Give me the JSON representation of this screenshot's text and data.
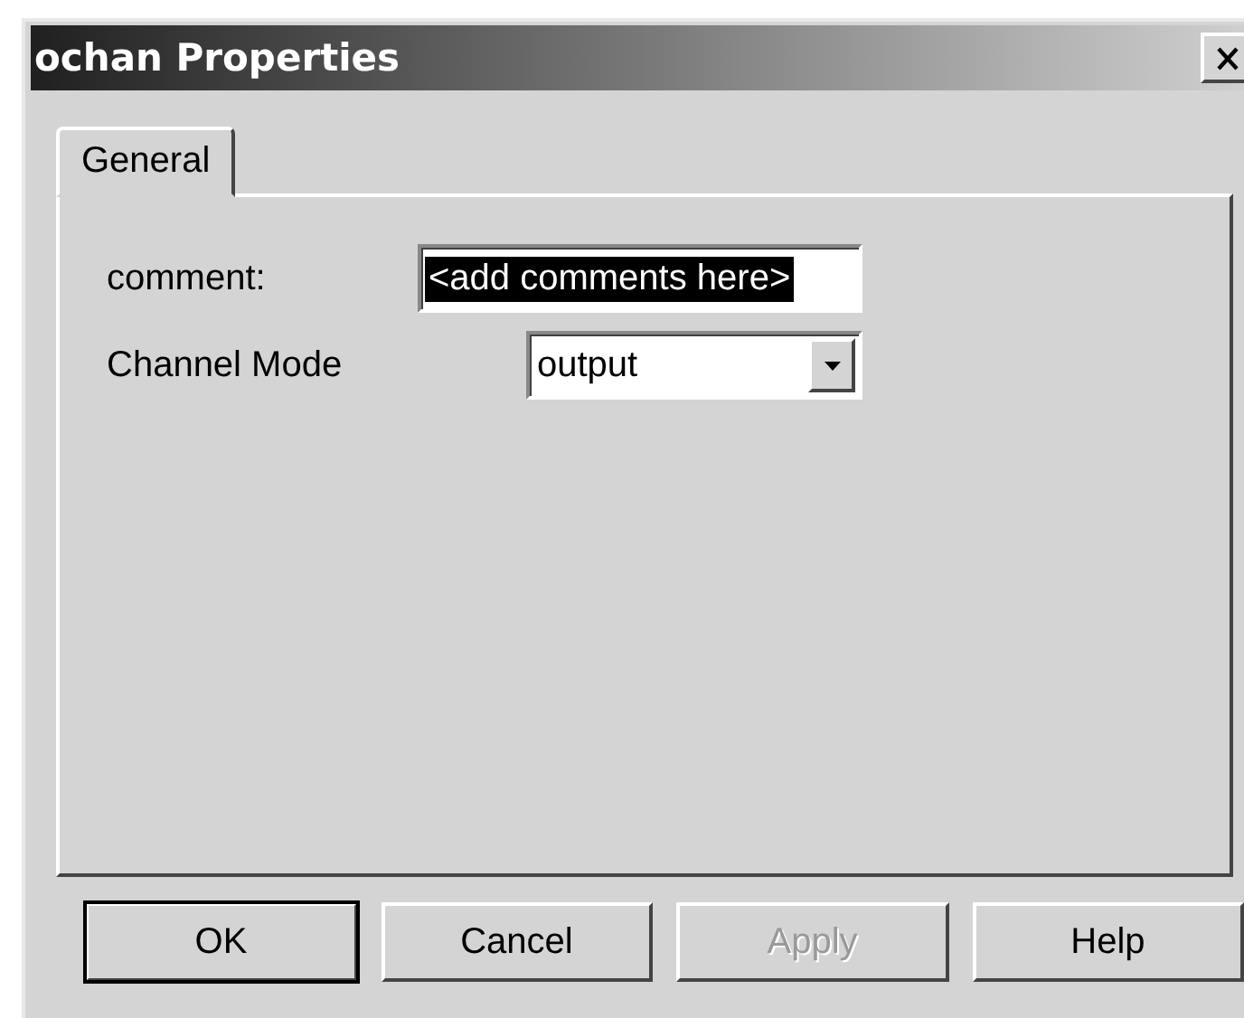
{
  "window": {
    "title": "ochan Properties"
  },
  "tabs": [
    {
      "label": "General",
      "selected": true
    }
  ],
  "fields": [
    {
      "kind": "text",
      "label": "comment:",
      "value": "<add comments here>",
      "text_selected": true
    },
    {
      "kind": "dropdown",
      "label": "Channel Mode",
      "value": "output"
    }
  ],
  "buttons": [
    {
      "label": "OK",
      "default": true,
      "disabled": false
    },
    {
      "label": "Cancel",
      "default": false,
      "disabled": false
    },
    {
      "label": "Apply",
      "default": false,
      "disabled": true
    },
    {
      "label": "Help",
      "default": false,
      "disabled": false
    }
  ]
}
